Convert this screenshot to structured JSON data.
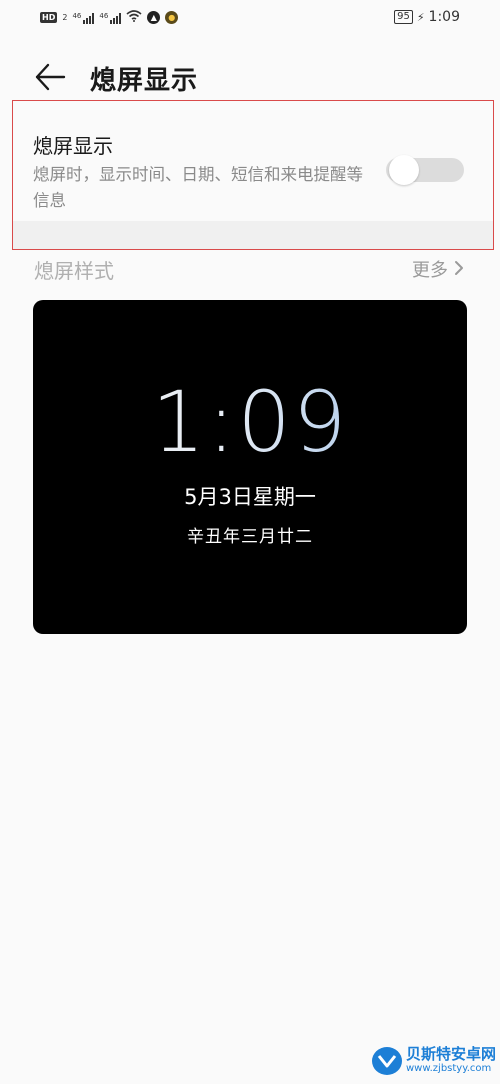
{
  "status_bar": {
    "hd": "HD",
    "hd_sub": "2",
    "net1": "46",
    "net2": "46",
    "battery": "95",
    "time": "1:09"
  },
  "header": {
    "title": "熄屏显示"
  },
  "setting": {
    "title": "熄屏显示",
    "description": "熄屏时，显示时间、日期、短信和来电提醒等信息",
    "toggle_on": false
  },
  "section": {
    "title": "熄屏样式",
    "more": "更多"
  },
  "preview": {
    "time": "1:09",
    "date": "5月3日星期一",
    "lunar": "辛丑年三月廿二"
  },
  "watermark": {
    "name": "贝斯特安卓网",
    "url": "www.zjbstyy.com"
  },
  "colors": {
    "accent_border": "#d94a4a",
    "toggle_off": "#dcdcdc",
    "watermark": "#1d7fd6"
  }
}
